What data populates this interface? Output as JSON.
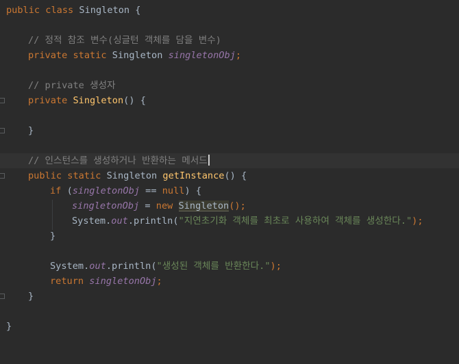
{
  "editor": {
    "theme": "darcula",
    "colors": {
      "background": "#2b2b2b",
      "keyword": "#cc7832",
      "method": "#ffc66d",
      "field": "#9876aa",
      "string": "#6a8759",
      "comment": "#808080",
      "text": "#a9b7c6"
    },
    "lines": {
      "l1": {
        "kw": "public class ",
        "name": "Singleton",
        "end": " {"
      },
      "l3": {
        "comment": "// 정적 참조 변수(싱글턴 객체를 담을 변수)"
      },
      "l4": {
        "kw": "private static ",
        "type": "Singleton ",
        "field": "singletonObj",
        "end": ";"
      },
      "l6": {
        "comment": "// private 생성자"
      },
      "l7": {
        "kw": "private ",
        "method": "Singleton",
        "end": "() {"
      },
      "l9": {
        "end": "}"
      },
      "l11": {
        "comment": "// 인스턴스를 생성하거나 반환하는 메서드"
      },
      "l12": {
        "kw": "public static ",
        "type": "Singleton ",
        "method": "getInstance",
        "end": "() {"
      },
      "l13": {
        "kw_if": "if ",
        "open": "(",
        "field": "singletonObj",
        "op": " == ",
        "kw_null": "null",
        "end": ") {"
      },
      "l14": {
        "field": "singletonObj",
        "op": " = ",
        "kw_new": "new ",
        "ctor": "Singleton",
        "end": "();"
      },
      "l15": {
        "prefix": "System.",
        "out": "out",
        "call": ".println(",
        "str": "\"지연초기화 객체를 최초로 사용하여 객체를 생성한다.\"",
        "end": ");"
      },
      "l16": {
        "end": "}"
      },
      "l18": {
        "prefix": "System.",
        "out": "out",
        "call": ".println(",
        "str": "\"생성된 객체를 반환한다.\"",
        "end": ");"
      },
      "l19": {
        "kw": "return ",
        "field": "singletonObj",
        "end": ";"
      },
      "l20": {
        "end": "}"
      },
      "l22": {
        "end": "}"
      }
    }
  }
}
